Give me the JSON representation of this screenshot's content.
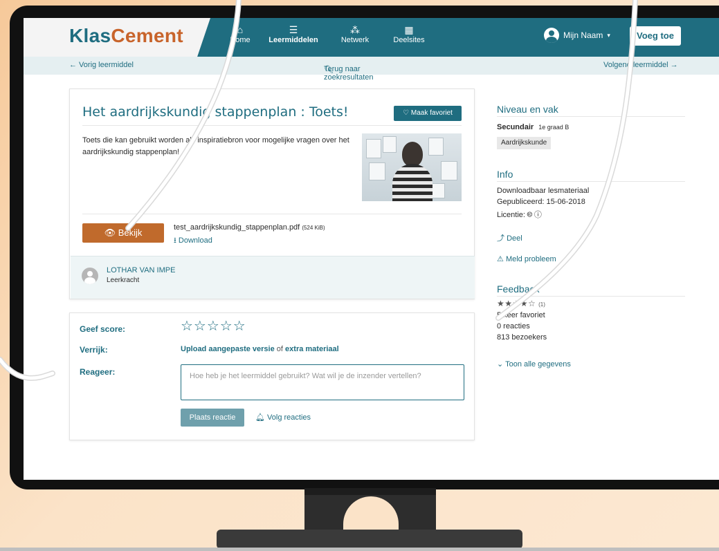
{
  "header": {
    "brand_part1": "Klas",
    "brand_part2": "Cement",
    "nav": [
      {
        "icon": "home-icon",
        "label": "Home"
      },
      {
        "icon": "list-icon",
        "label": "Leermiddelen"
      },
      {
        "icon": "network-icon",
        "label": "Netwerk"
      },
      {
        "icon": "grid-icon",
        "label": "Deelsites"
      }
    ],
    "user_name": "Mijn Naam",
    "add_label": "Voeg toe"
  },
  "subnav": {
    "prev": "← Vorig leermiddel",
    "back": "Terug naar zoekresultaten",
    "next": "Volgend leermiddel →"
  },
  "resource": {
    "title": "Het aardrijkskundig stappenplan : Toets!",
    "favorite_label": "Maak favoriet",
    "description": "Toets die kan gebruikt worden als inspiratiebron voor mogelijke vragen over het aardrijkskundig stappenplan!",
    "view_label": "Bekijk",
    "file_name": "test_aardrijkskundig_stappenplan.pdf",
    "file_size": "(524 KiB)",
    "download_label": "Download",
    "author_name": "LOTHAR VAN IMPE",
    "author_role": "Leerkracht"
  },
  "feedback_form": {
    "score_label": "Geef score:",
    "stars_empty": "☆☆☆☆☆",
    "enrich_label": "Verrijk:",
    "enrich_link1": "Upload aangepaste versie",
    "enrich_of": "of",
    "enrich_link2": "extra materiaal",
    "reply_label": "Reageer:",
    "reply_placeholder": "Hoe heb je het leermiddel gebruikt? Wat wil je de inzender vertellen?",
    "post_label": "Plaats reactie",
    "follow_label": "Volg reacties"
  },
  "sidebar": {
    "level_heading": "Niveau en vak",
    "level": "Secundair",
    "grade": "1e graad B",
    "subject": "Aardrijkskunde",
    "info_heading": "Info",
    "info_lines": [
      "Downloadbaar lesmateriaal",
      "Gepubliceerd: 15-06-2018",
      "Licentie:"
    ],
    "license_symbols": "🅭 ⓘ",
    "share_label": "Deel",
    "report_label": "Meld probleem",
    "feedback_heading": "Feedback",
    "rating_stars": "★★★★☆",
    "rating_count": "(1)",
    "rating_value": 4,
    "stats": [
      "5 keer favoriet",
      "0 reacties",
      "813 bezoekers"
    ],
    "show_all_label": "Toon alle gegevens"
  },
  "colors": {
    "primary": "#1f6d80",
    "accent": "#c06a2c",
    "subbar_bg": "#e5eff1"
  }
}
